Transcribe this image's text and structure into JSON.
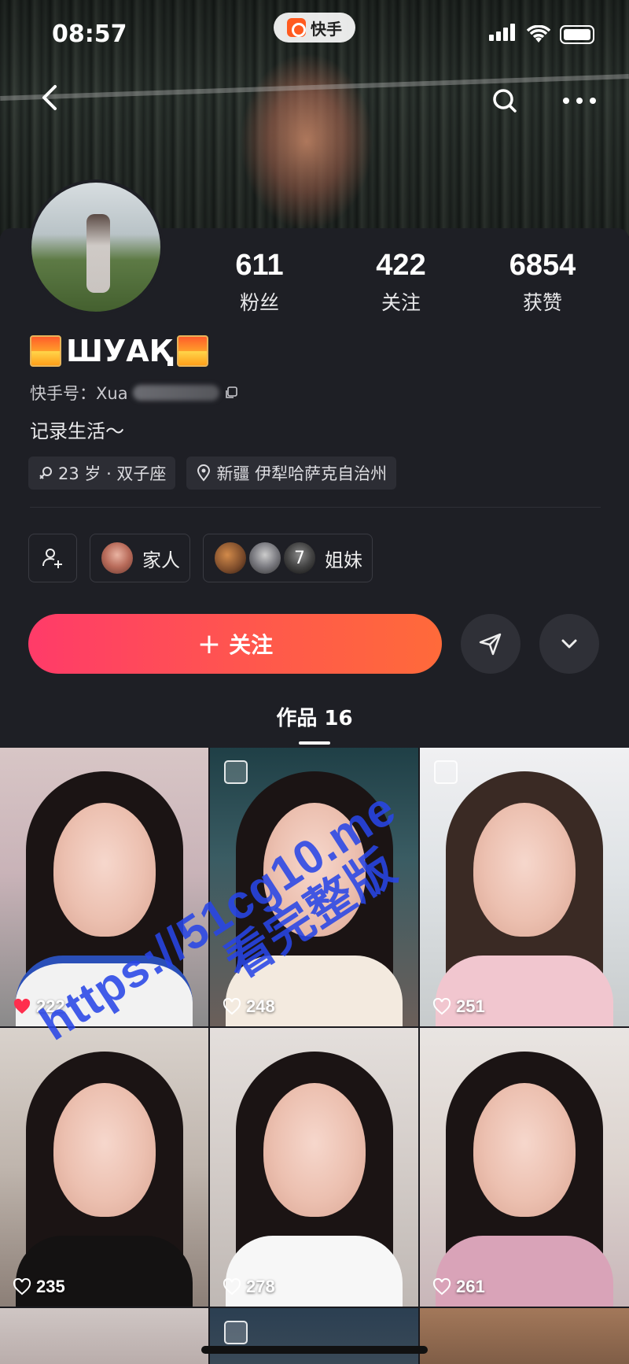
{
  "status_bar": {
    "time": "08:57",
    "app_pill": "快手"
  },
  "profile": {
    "stats": [
      {
        "value": "611",
        "label": "粉丝"
      },
      {
        "value": "422",
        "label": "关注"
      },
      {
        "value": "6854",
        "label": "获赞"
      }
    ],
    "name": "ШУАҚ",
    "ks_id_label": "快手号：Xua",
    "bio": "记录生活～",
    "tags": [
      "23 岁 · 双子座",
      "新疆 伊犁哈萨克自治州"
    ],
    "relations": [
      {
        "label": "家人"
      },
      {
        "label": "姐妹",
        "more_count": "7"
      }
    ]
  },
  "actions": {
    "follow_label": "关注"
  },
  "tabs": {
    "works": "作品 16"
  },
  "grid": [
    {
      "likes": "222",
      "liked": true
    },
    {
      "likes": "248",
      "liked": false,
      "image_post": true
    },
    {
      "likes": "251",
      "liked": false,
      "image_post": true
    },
    {
      "likes": "235",
      "liked": false
    },
    {
      "likes": "278",
      "liked": false
    },
    {
      "likes": "261",
      "liked": false
    }
  ],
  "watermark": {
    "line1": "https://51cg10.me",
    "line2": "看完整版"
  },
  "colors": {
    "accent_start": "#ff3b69",
    "accent_end": "#ff6a3a",
    "background": "#1e1f25",
    "liked_heart": "#ff2e4d"
  }
}
